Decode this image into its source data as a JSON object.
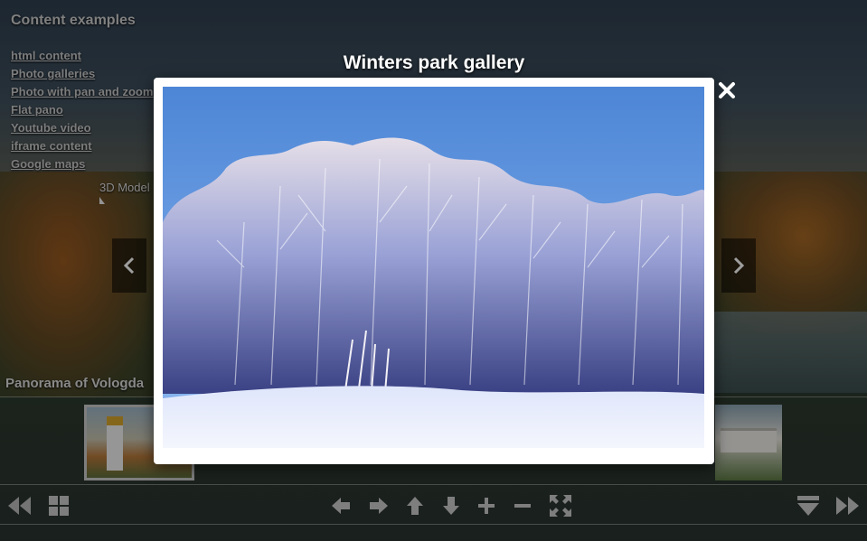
{
  "menu": {
    "title": "Content examples",
    "items": [
      "html content",
      "Photo galleries",
      "Photo with pan and zoom",
      "Flat pano",
      "Youtube video",
      "iframe content",
      "Google maps"
    ]
  },
  "hotspot": {
    "label": "3D Model"
  },
  "panorama": {
    "title": "Panorama of Vologda"
  },
  "lightbox": {
    "title": "Winters park gallery",
    "close_icon": "close-icon"
  },
  "navigation": {
    "prev_icon": "chevron-left-icon",
    "next_icon": "chevron-right-icon"
  },
  "toolbar": {
    "icons": [
      "rewind-icon",
      "grid-icon",
      "arrow-left-icon",
      "arrow-right-icon",
      "arrow-up-icon",
      "arrow-down-icon",
      "zoom-in-icon",
      "zoom-out-icon",
      "fullscreen-icon",
      "hide-thumbnails-icon",
      "fast-forward-icon"
    ]
  },
  "colors": {
    "overlay": "#000000",
    "frame": "#ffffff",
    "sky": "#5e90d8",
    "snow": "#e8eefc"
  }
}
